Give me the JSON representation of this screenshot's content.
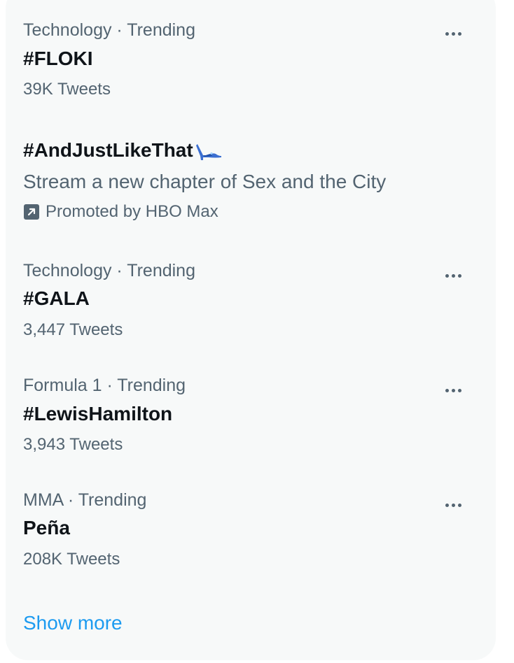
{
  "trends": [
    {
      "category": "Technology · Trending",
      "title": "#FLOKI",
      "tweets": "39K Tweets"
    },
    {
      "category": "Technology · Trending",
      "title": "#GALA",
      "tweets": "3,447 Tweets"
    },
    {
      "category": "Formula 1 · Trending",
      "title": "#LewisHamilton",
      "tweets": "3,943 Tweets"
    },
    {
      "category": "MMA · Trending",
      "title": "Peña",
      "tweets": "208K Tweets"
    }
  ],
  "promoted": {
    "title": "#AndJustLikeThat",
    "title_icon": "high-heel-shoe-emoji",
    "description": "Stream a new chapter of Sex and the City",
    "promoted_label": "Promoted by HBO Max",
    "promoted_icon": "promoted-arrow-icon"
  },
  "show_more_label": "Show more",
  "colors": {
    "panel_background": "#f7f9f9",
    "primary_text": "#0f1419",
    "secondary_text": "#536471",
    "link": "#1d9bf0"
  }
}
